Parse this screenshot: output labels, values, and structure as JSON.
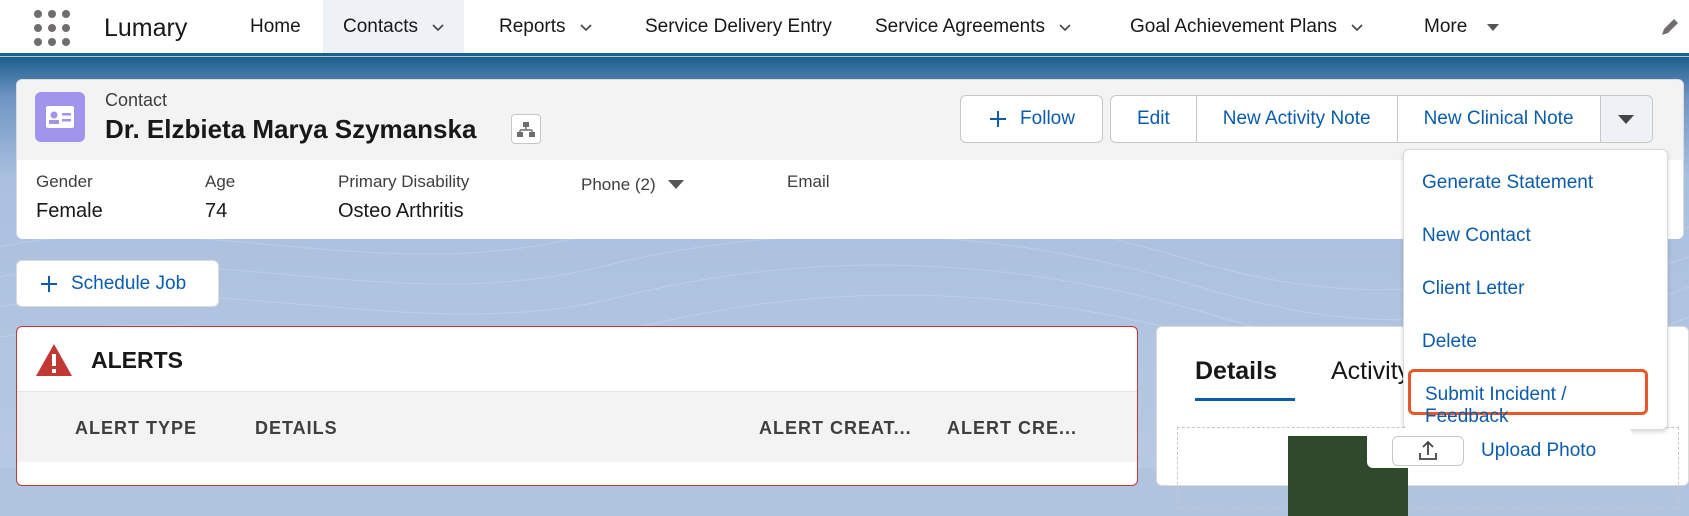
{
  "app": {
    "name": "Lumary"
  },
  "nav": {
    "items": [
      {
        "label": "Home",
        "has_menu": false
      },
      {
        "label": "Contacts",
        "has_menu": true,
        "active": true
      },
      {
        "label": "Reports",
        "has_menu": true
      },
      {
        "label": "Service Delivery Entry",
        "has_menu": false
      },
      {
        "label": "Service Agreements",
        "has_menu": true
      },
      {
        "label": "Goal Achievement Plans",
        "has_menu": true
      },
      {
        "label": "More",
        "has_menu": true
      }
    ]
  },
  "record": {
    "object_label": "Contact",
    "name": "Dr. Elzbieta Marya Szymanska",
    "fields": [
      {
        "label": "Gender",
        "value": "Female"
      },
      {
        "label": "Age",
        "value": "74"
      },
      {
        "label": "Primary Disability",
        "value": "Osteo Arthritis"
      },
      {
        "label": "Phone (2)",
        "value": ""
      },
      {
        "label": "Email",
        "value": ""
      }
    ]
  },
  "actions": {
    "follow": "Follow",
    "edit": "Edit",
    "new_activity_note": "New Activity Note",
    "new_clinical_note": "New Clinical Note"
  },
  "menu": {
    "items": [
      "Generate Statement",
      "New Contact",
      "Client Letter",
      "Delete",
      "Submit Incident / Feedback"
    ],
    "highlighted_index": 4
  },
  "schedule_job": "Schedule Job",
  "alerts": {
    "title": "ALERTS",
    "columns": [
      "ALERT TYPE",
      "DETAILS",
      "ALERT CREAT...",
      "ALERT CRE..."
    ]
  },
  "details_panel": {
    "tabs": [
      "Details",
      "Activity"
    ],
    "upload_label": "Upload Photo"
  },
  "colors": {
    "brand_blue": "#0b5cab",
    "highlight": "#e8582a",
    "alert_red": "#c23934"
  }
}
